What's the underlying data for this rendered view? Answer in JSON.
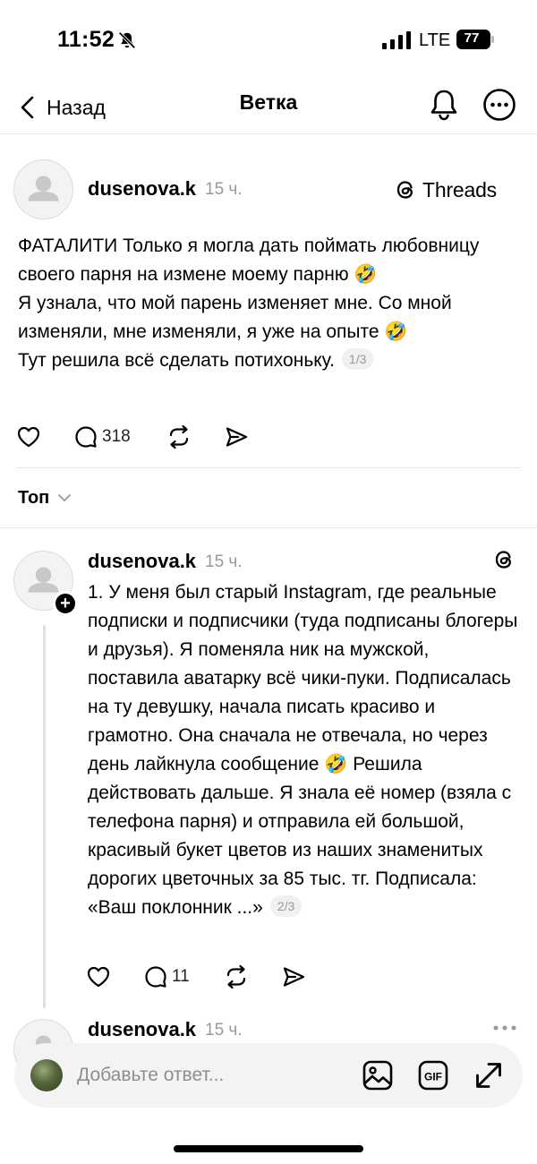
{
  "status_bar": {
    "time": "11:52",
    "network": "LTE",
    "battery": "77"
  },
  "nav": {
    "back_label": "Назад",
    "title": "Ветка"
  },
  "main_post": {
    "username": "dusenova.k",
    "time": "15 ч.",
    "app_badge": "Threads",
    "paragraphs": [
      "ФАТАЛИТИ Только я могла дать поймать любовницу своего парня на измене моему парню 🤣",
      "Я узнала, что мой парень изменяет мне. Со мной изменяли, мне изменяли, я уже на опыте 🤣",
      "Тут решила всё сделать потихоньку."
    ],
    "counter": "1/3",
    "comments": "318"
  },
  "sort": {
    "label": "Топ"
  },
  "reply_1": {
    "username": "dusenova.k",
    "time": "15 ч.",
    "text": "1. У меня был старый Instagram, где реальные подписки и подписчики (туда подписаны блогеры и друзья). Я поменяла ник на мужской, поставила аватарку всё чики-пуки. Подписалась на ту девушку, начала писать красиво и грамотно. Она сначала не отвечала, но через день лайкнула сообщение 🤣 Решила действовать дальше. Я знала её номер (взяла с телефона парня) и отправила ей большой, красивый букет цветов из наших знаменитых дорогих цветочных  за 85 тыс. тг. Подписала: «Ваш поклонник ...»",
    "counter": "2/3",
    "comments": "11"
  },
  "reply_2": {
    "username": "dusenova.k",
    "time": "15 ч."
  },
  "reply_bar": {
    "placeholder": "Добавьте ответ..."
  },
  "icons": {
    "back": "chevron-left-icon",
    "bell": "bell-icon",
    "more": "more-horizontal-icon",
    "like": "heart-icon",
    "comment": "comment-icon",
    "repost": "repost-icon",
    "share": "share-icon",
    "image": "image-icon",
    "gif": "gif-icon",
    "expand": "expand-icon"
  }
}
